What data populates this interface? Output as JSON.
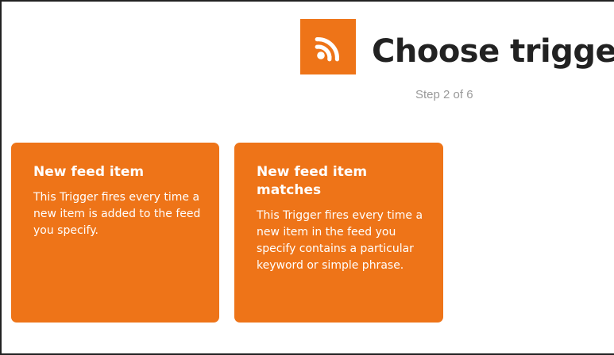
{
  "header": {
    "service_icon": "rss-feed-icon",
    "title": "Choose trigger",
    "step": "Step 2 of 6"
  },
  "triggers": [
    {
      "title": "New feed item",
      "description": "This Trigger fires every time a new item is added to the feed you specify."
    },
    {
      "title": "New feed item matches",
      "description": "This Trigger fires every time a new item in the feed you specify contains a particular keyword or simple phrase."
    }
  ],
  "colors": {
    "brand": "#ee7418",
    "title_text": "#222222",
    "step_text": "#999999",
    "card_text": "#ffffff"
  }
}
